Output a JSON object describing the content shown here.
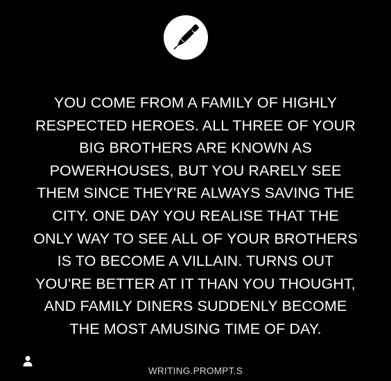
{
  "icons": {
    "logo": "pen-icon",
    "user": "user-icon"
  },
  "colors": {
    "background": "#000000",
    "text": "#ffffff",
    "logo_circle": "#ffffff",
    "logo_pen": "#000000"
  },
  "prompt": {
    "lines": [
      "YOU COME FROM A FAMILY OF HIGHLY",
      "RESPECTED HEROES. ALL THREE OF YOUR",
      "BIG BROTHERS ARE KNOWN AS",
      "POWERHOUSES, BUT YOU RARELY SEE",
      "THEM SINCE THEY'RE ALWAYS SAVING THE",
      "CITY. ONE DAY YOU REALISE THAT THE",
      "ONLY WAY TO SEE ALL OF YOUR BROTHERS",
      "IS TO BECOME A VILLAIN. TURNS OUT",
      "YOU'RE BETTER AT IT THAN YOU THOUGHT,",
      "AND FAMILY DINERS SUDDENLY BECOME",
      "THE MOST AMUSING TIME OF DAY."
    ]
  },
  "footer": {
    "handle": "WRITING.PROMPT.S"
  }
}
